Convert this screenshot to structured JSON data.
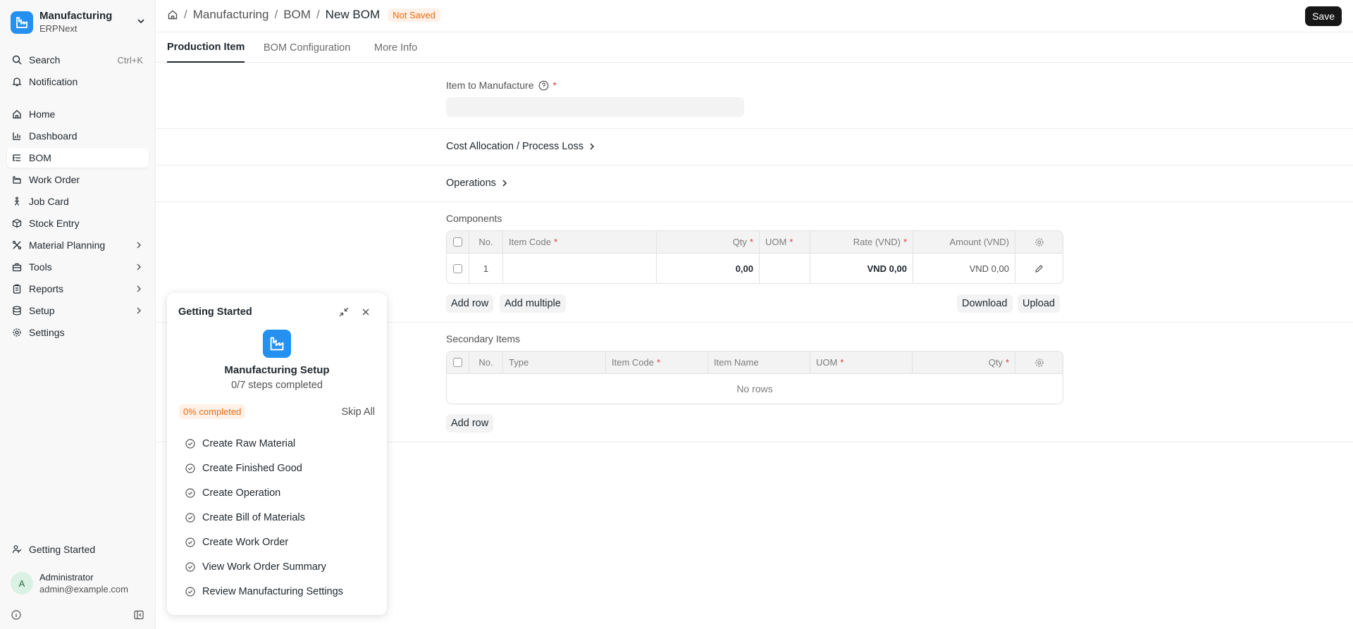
{
  "app": {
    "title": "Manufacturing",
    "subtitle": "ERPNext",
    "brand_color": "#2490ef"
  },
  "sidebar": {
    "search": {
      "label": "Search",
      "shortcut": "Ctrl+K"
    },
    "notification": "Notification",
    "items": [
      {
        "label": "Home",
        "icon": "home-icon"
      },
      {
        "label": "Dashboard",
        "icon": "bar-chart-icon"
      },
      {
        "label": "BOM",
        "icon": "list-tree-icon",
        "active": true
      },
      {
        "label": "Work Order",
        "icon": "factory-icon"
      },
      {
        "label": "Job Card",
        "icon": "person-walking-icon"
      },
      {
        "label": "Stock Entry",
        "icon": "box-icon"
      },
      {
        "label": "Material Planning",
        "icon": "tools-cross-icon",
        "expandable": true
      },
      {
        "label": "Tools",
        "icon": "toolbox-icon",
        "expandable": true
      },
      {
        "label": "Reports",
        "icon": "clipboard-icon",
        "expandable": true
      },
      {
        "label": "Setup",
        "icon": "database-icon",
        "expandable": true
      },
      {
        "label": "Settings",
        "icon": "gear-icon"
      }
    ],
    "getting_started": "Getting Started",
    "user": {
      "initial": "A",
      "name": "Administrator",
      "email": "admin@example.com"
    }
  },
  "header": {
    "breadcrumbs": [
      "Manufacturing",
      "BOM",
      "New BOM"
    ],
    "status_badge": "Not Saved",
    "save_label": "Save"
  },
  "tabs": [
    "Production Item",
    "BOM Configuration",
    "More Info"
  ],
  "form": {
    "item_to_manufacture": {
      "label": "Item to Manufacture",
      "value": ""
    },
    "cost_allocation": "Cost Allocation / Process Loss",
    "operations": "Operations",
    "components": {
      "title": "Components",
      "columns": [
        "No.",
        "Item Code",
        "Qty",
        "UOM",
        "Rate (VND)",
        "Amount (VND)"
      ],
      "rows": [
        {
          "no": "1",
          "item_code": "",
          "qty": "0,00",
          "uom": "",
          "rate": "VND 0,00",
          "amount": "VND 0,00"
        }
      ],
      "add_row": "Add row",
      "add_multiple": "Add multiple",
      "download": "Download",
      "upload": "Upload"
    },
    "secondary_items": {
      "title": "Secondary Items",
      "columns": [
        "No.",
        "Type",
        "Item Code",
        "Item Name",
        "UOM",
        "Qty"
      ],
      "empty_text": "No rows",
      "add_row": "Add row"
    }
  },
  "getting_started_panel": {
    "title": "Getting Started",
    "setup_name": "Manufacturing Setup",
    "steps_completed": "0/7 steps completed",
    "progress_badge": "0% completed",
    "progress_percent": 0,
    "skip_all": "Skip All",
    "steps": [
      "Create Raw Material",
      "Create Finished Good",
      "Create Operation",
      "Create Bill of Materials",
      "Create Work Order",
      "View Work Order Summary",
      "Review Manufacturing Settings"
    ]
  }
}
